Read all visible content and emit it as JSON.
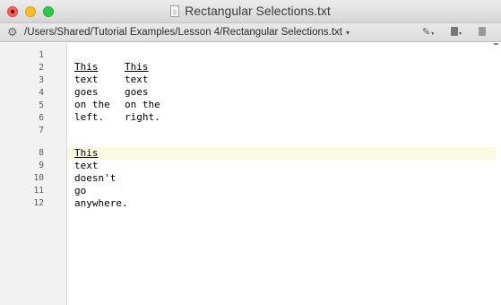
{
  "window": {
    "title": "Rectangular Selections.txt",
    "path": "/Users/Shared/Tutorial Examples/Lesson 4/Rectangular Selections.txt",
    "path_chevron": "▾",
    "toolbar": {
      "pencil_icon": "✎",
      "chevron": "▾"
    }
  },
  "editor": {
    "current_line": 8,
    "line_numbers": [
      "1",
      "2",
      "3",
      "4",
      "5",
      "6",
      "7",
      "8",
      "9",
      "10",
      "11",
      "12"
    ],
    "lines": {
      "l2a": "This",
      "l2b": "This",
      "l3a": "text",
      "l3b": "text",
      "l4a": "goes",
      "l4b": "goes",
      "l5a": "on the",
      "l5b": "on the",
      "l6a": "left.",
      "l6b": "right.",
      "l8": "This",
      "l9": "text",
      "l10": "doesn't",
      "l11": "go",
      "l12": "anywhere."
    }
  },
  "colors": {
    "close": "#fc5f57",
    "minimize": "#fdbc2e",
    "zoom": "#33c748",
    "current_line_highlight": "#fafae3",
    "gutter": "#f2f2f2"
  }
}
